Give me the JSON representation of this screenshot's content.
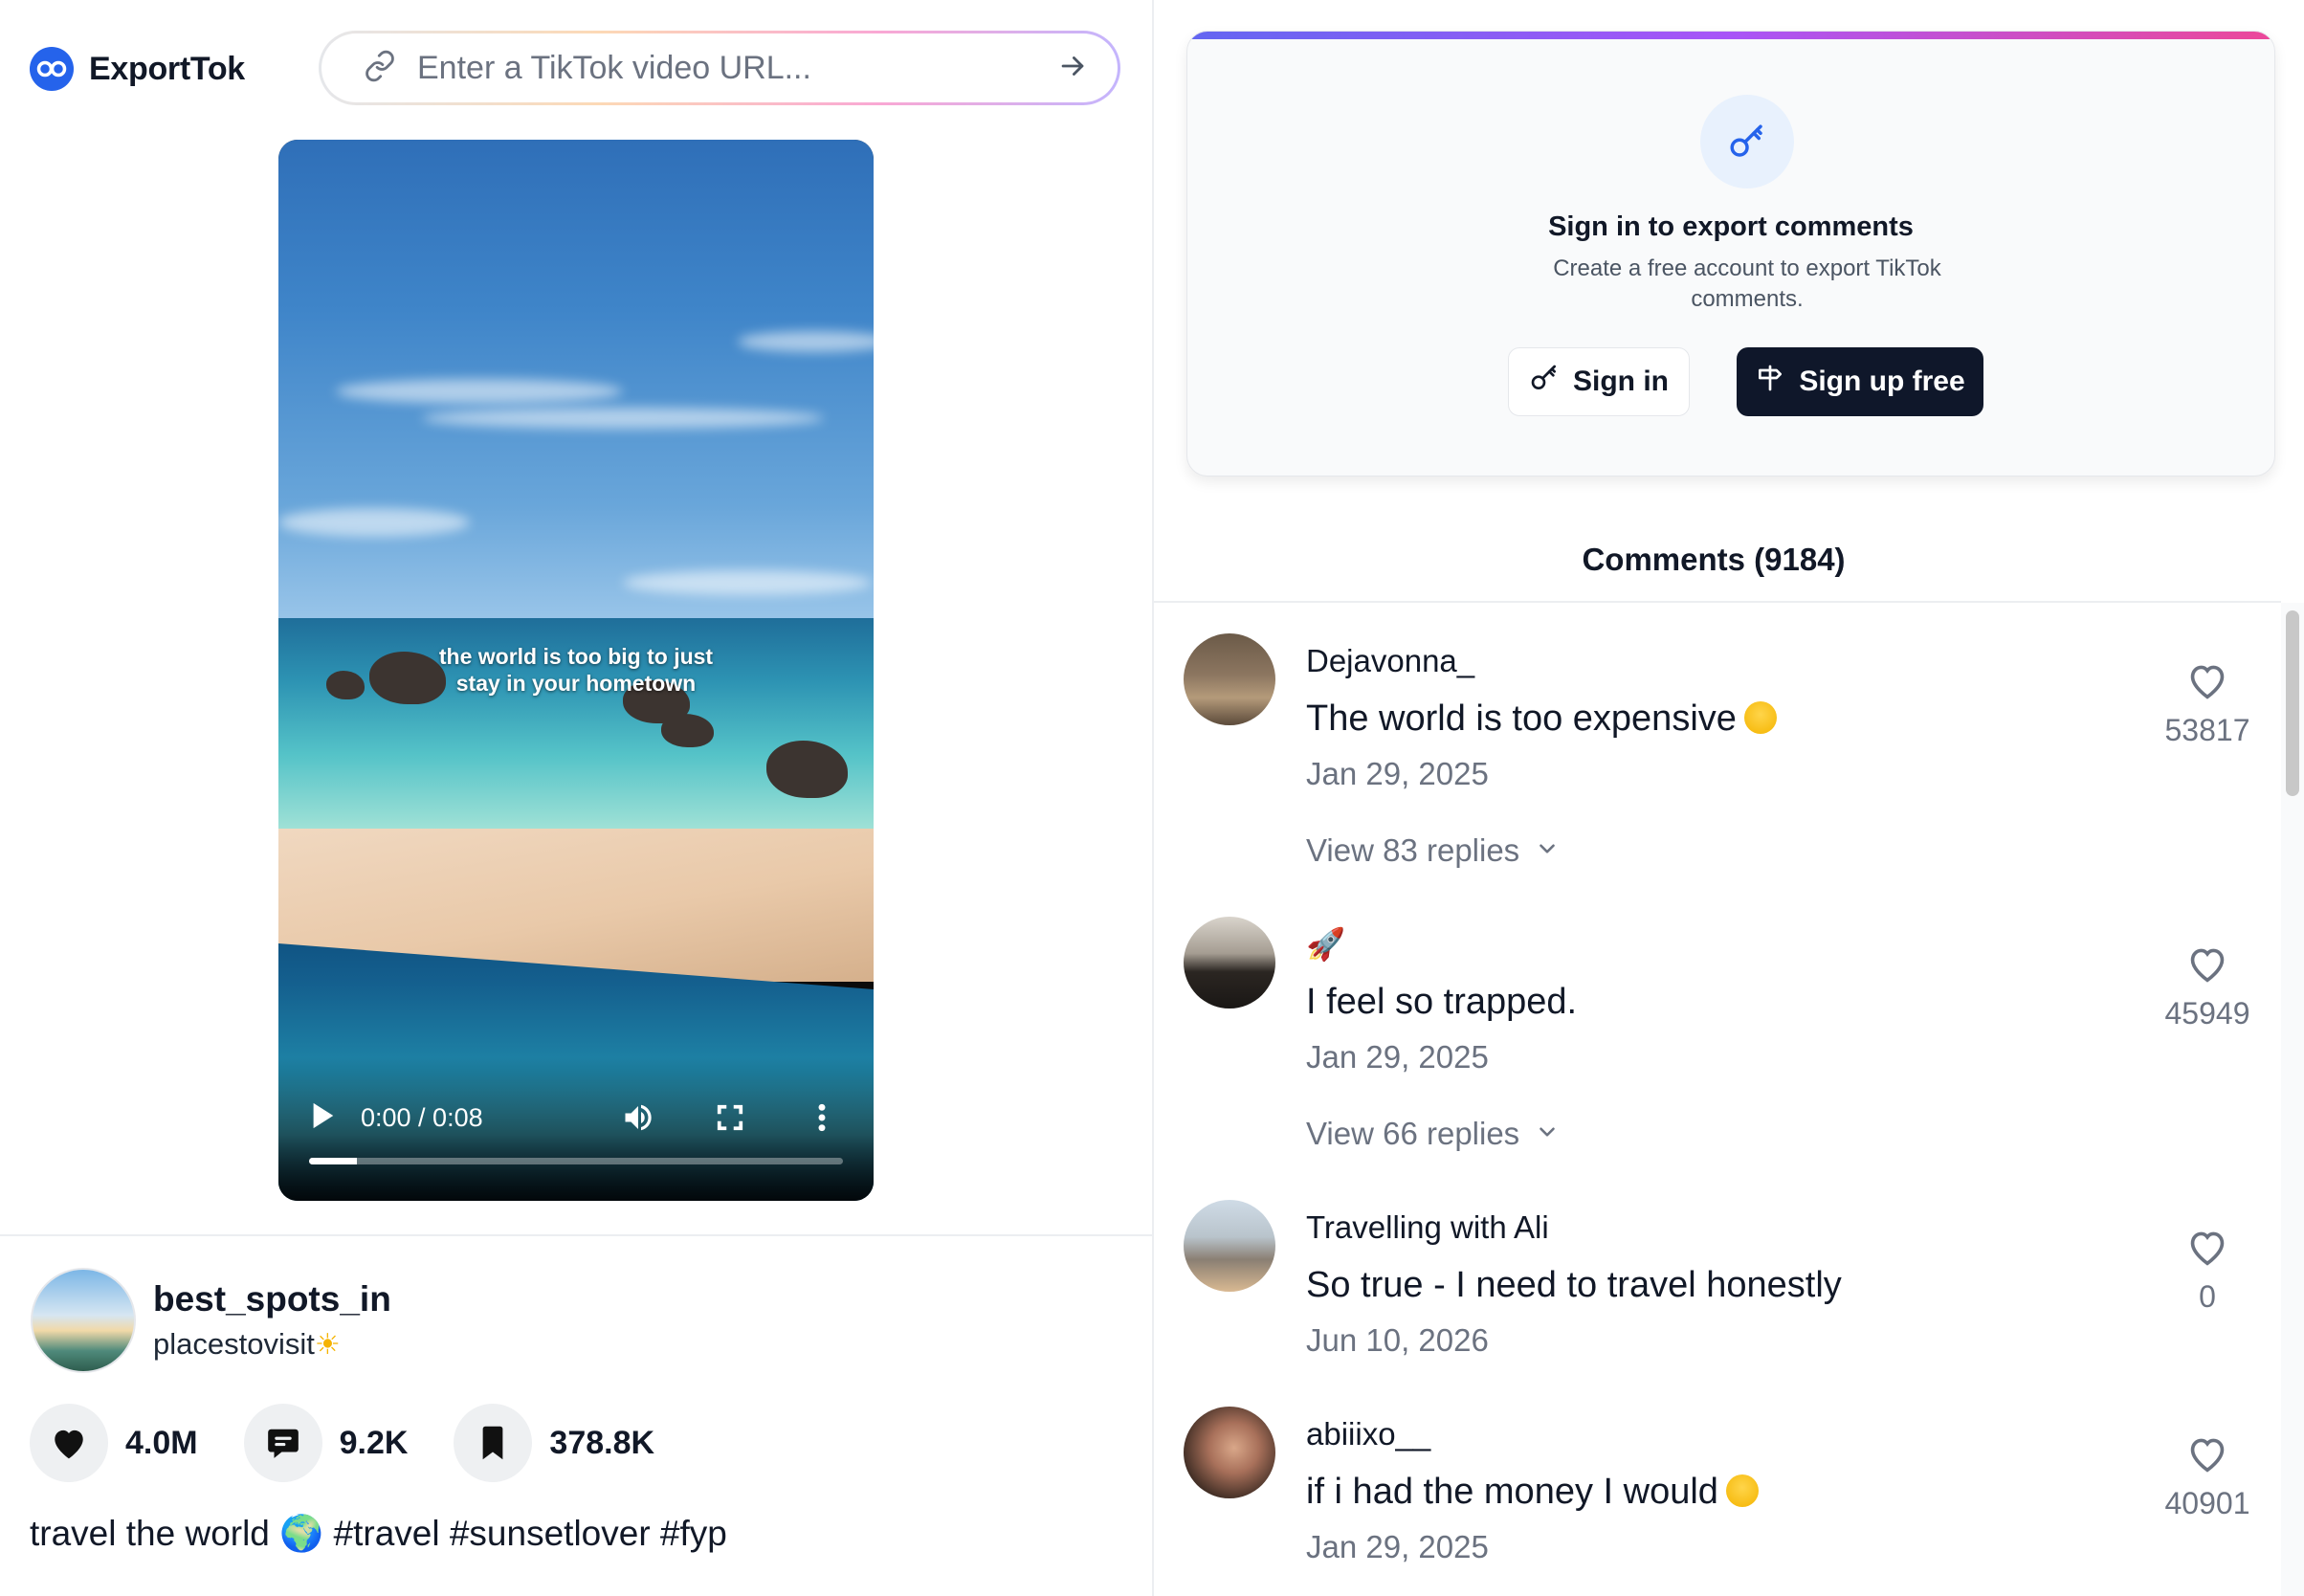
{
  "brand": {
    "name": "ExportTok"
  },
  "search": {
    "placeholder": "Enter a TikTok video URL..."
  },
  "video": {
    "overlay_line1": "the world is too big to just",
    "overlay_line2": "stay in your hometown",
    "time": "0:00 / 0:08",
    "progress_fraction": 0.09
  },
  "author": {
    "username": "best_spots_in",
    "display_name": "placestovisit"
  },
  "stats": {
    "likes": "4.0M",
    "comments": "9.2K",
    "saves": "378.8K"
  },
  "caption": "travel the world 🌍 #travel #sunsetlover #fyp",
  "auth_card": {
    "title": "Sign in to export comments",
    "description": "Create a free account to export TikTok comments.",
    "sign_in": "Sign in",
    "sign_up": "Sign up free"
  },
  "comments": {
    "header": "Comments (9184)",
    "items": [
      {
        "user": "Dejavonna_",
        "text": "The world is too expensive",
        "date": "Jan 29, 2025",
        "likes": "53817",
        "replies": "View 83 replies"
      },
      {
        "user": "🚀",
        "text": "I feel so trapped.",
        "date": "Jan 29, 2025",
        "likes": "45949",
        "replies": "View 66 replies"
      },
      {
        "user": "Travelling with Ali",
        "text": "So true - I need to travel honestly",
        "date": "Jun 10, 2026",
        "likes": "0"
      },
      {
        "user": "abiiixo__",
        "text": "if i had the money I would",
        "date": "Jan 29, 2025",
        "likes": "40901"
      }
    ]
  },
  "colors": {
    "brand": "#2563eb",
    "dark_button": "#0f172a",
    "muted_text": "#6b7280"
  }
}
